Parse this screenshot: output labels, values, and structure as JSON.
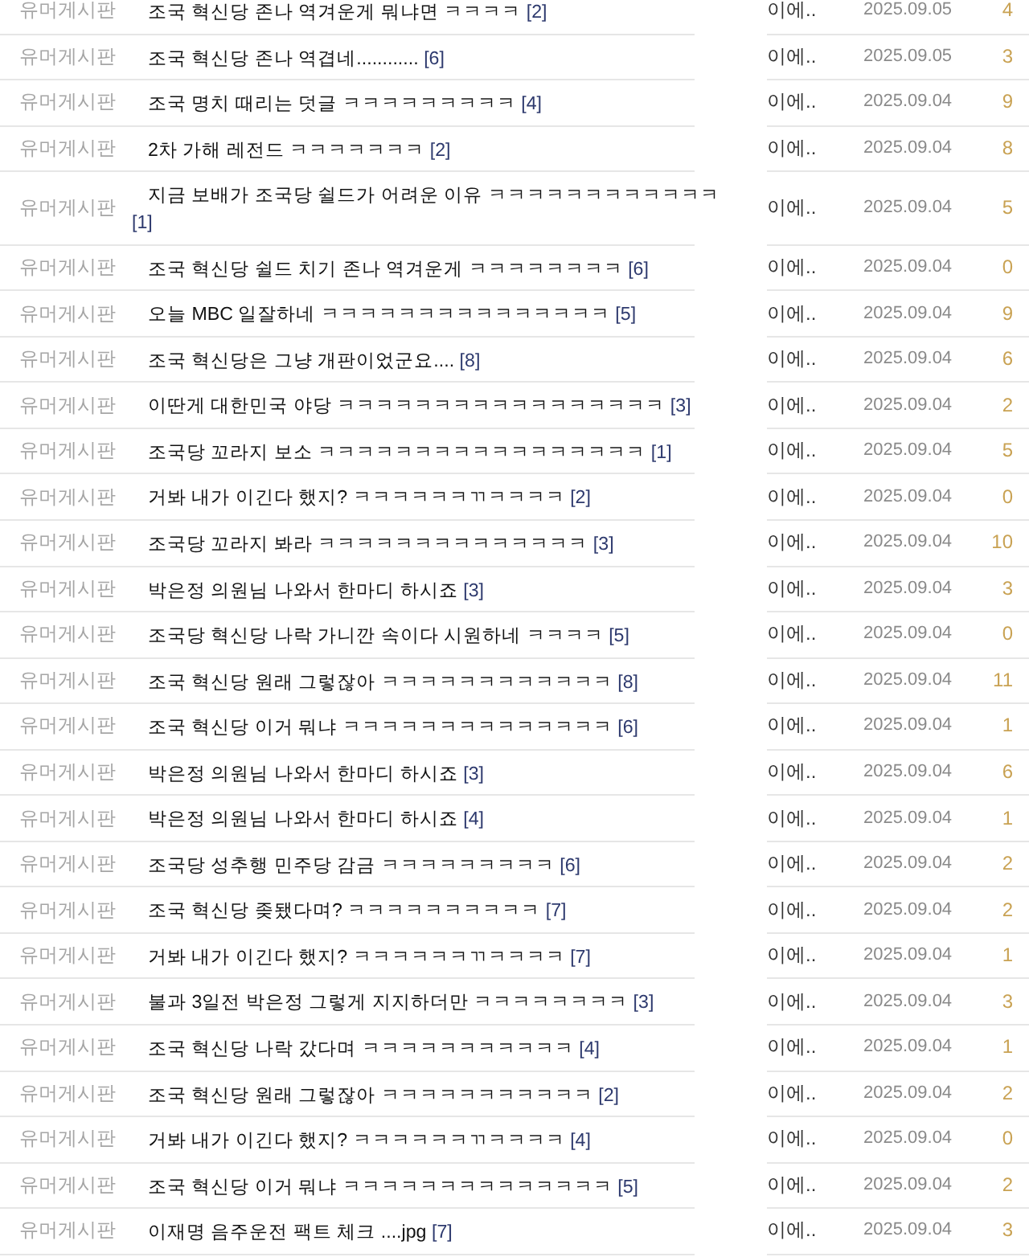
{
  "posts": [
    {
      "board": "유머게시판",
      "title": "조국 혁신당 존나 역겨운게 뭐냐면 ㅋㅋㅋㅋ",
      "comment_count": "[2]",
      "author": "이에..",
      "date": "2025.09.05",
      "count": "4"
    },
    {
      "board": "유머게시판",
      "title": "조국 혁신당 존나 역겹네............",
      "comment_count": "[6]",
      "author": "이에..",
      "date": "2025.09.05",
      "count": "3"
    },
    {
      "board": "유머게시판",
      "title": "조국 명치 때리는 덧글 ㅋㅋㅋㅋㅋㅋㅋㅋㅋ",
      "comment_count": "[4]",
      "author": "이에..",
      "date": "2025.09.04",
      "count": "9"
    },
    {
      "board": "유머게시판",
      "title": "2차 가해 레전드 ㅋㅋㅋㅋㅋㅋㅋ",
      "comment_count": "[2]",
      "author": "이에..",
      "date": "2025.09.04",
      "count": "8"
    },
    {
      "board": "유머게시판",
      "title": "지금 보배가 조국당 쉴드가 어려운 이유 ㅋㅋㅋㅋㅋㅋㅋㅋㅋㅋㅋㅋ",
      "comment_count": "[1]",
      "author": "이에..",
      "date": "2025.09.04",
      "count": "5"
    },
    {
      "board": "유머게시판",
      "title": "조국 혁신당 쉴드 치기 존나 역겨운게 ㅋㅋㅋㅋㅋㅋㅋㅋ",
      "comment_count": "[6]",
      "author": "이에..",
      "date": "2025.09.04",
      "count": "0"
    },
    {
      "board": "유머게시판",
      "title": "오늘 MBC 일잘하네 ㅋㅋㅋㅋㅋㅋㅋㅋㅋㅋㅋㅋㅋㅋㅋ",
      "comment_count": "[5]",
      "author": "이에..",
      "date": "2025.09.04",
      "count": "9"
    },
    {
      "board": "유머게시판",
      "title": "조국 혁신당은 그냥 개판이었군요....",
      "comment_count": "[8]",
      "author": "이에..",
      "date": "2025.09.04",
      "count": "6"
    },
    {
      "board": "유머게시판",
      "title": "이딴게 대한민국 야당 ㅋㅋㅋㅋㅋㅋㅋㅋㅋㅋㅋㅋㅋㅋㅋㅋㅋ",
      "comment_count": "[3]",
      "author": "이에..",
      "date": "2025.09.04",
      "count": "2"
    },
    {
      "board": "유머게시판",
      "title": "조국당 꼬라지 보소 ㅋㅋㅋㅋㅋㅋㅋㅋㅋㅋㅋㅋㅋㅋㅋㅋㅋ",
      "comment_count": "[1]",
      "author": "이에..",
      "date": "2025.09.04",
      "count": "5"
    },
    {
      "board": "유머게시판",
      "title": "거봐 내가 이긴다 했지? ㅋㅋㅋㅋㅋㅋㄲㅋㅋㅋㅋ",
      "comment_count": "[2]",
      "author": "이에..",
      "date": "2025.09.04",
      "count": "0"
    },
    {
      "board": "유머게시판",
      "title": "조국당 꼬라지 봐라 ㅋㅋㅋㅋㅋㅋㅋㅋㅋㅋㅋㅋㅋㅋ",
      "comment_count": "[3]",
      "author": "이에..",
      "date": "2025.09.04",
      "count": "10"
    },
    {
      "board": "유머게시판",
      "title": "박은정 의원님 나와서 한마디 하시죠",
      "comment_count": "[3]",
      "author": "이에..",
      "date": "2025.09.04",
      "count": "3"
    },
    {
      "board": "유머게시판",
      "title": "조국당 혁신당 나락 가니깐 속이다 시원하네 ㅋㅋㅋㅋ",
      "comment_count": "[5]",
      "author": "이에..",
      "date": "2025.09.04",
      "count": "0"
    },
    {
      "board": "유머게시판",
      "title": "조국 혁신당 원래 그렇잖아 ㅋㅋㅋㅋㅋㅋㅋㅋㅋㅋㅋㅋ",
      "comment_count": "[8]",
      "author": "이에..",
      "date": "2025.09.04",
      "count": "11"
    },
    {
      "board": "유머게시판",
      "title": "조국 혁신당 이거 뭐냐 ㅋㅋㅋㅋㅋㅋㅋㅋㅋㅋㅋㅋㅋㅋ",
      "comment_count": "[6]",
      "author": "이에..",
      "date": "2025.09.04",
      "count": "1"
    },
    {
      "board": "유머게시판",
      "title": "박은정 의원님 나와서 한마디 하시죠",
      "comment_count": "[3]",
      "author": "이에..",
      "date": "2025.09.04",
      "count": "6"
    },
    {
      "board": "유머게시판",
      "title": "박은정 의원님 나와서 한마디 하시죠",
      "comment_count": "[4]",
      "author": "이에..",
      "date": "2025.09.04",
      "count": "1"
    },
    {
      "board": "유머게시판",
      "title": "조국당 성추행 민주당 감금 ㅋㅋㅋㅋㅋㅋㅋㅋㅋ",
      "comment_count": "[6]",
      "author": "이에..",
      "date": "2025.09.04",
      "count": "2"
    },
    {
      "board": "유머게시판",
      "title": "조국 혁신당 좆됐다며? ㅋㅋㅋㅋㅋㅋㅋㅋㅋㅋ",
      "comment_count": "[7]",
      "author": "이에..",
      "date": "2025.09.04",
      "count": "2"
    },
    {
      "board": "유머게시판",
      "title": "거봐 내가 이긴다 했지? ㅋㅋㅋㅋㅋㅋㄲㅋㅋㅋㅋ",
      "comment_count": "[7]",
      "author": "이에..",
      "date": "2025.09.04",
      "count": "1"
    },
    {
      "board": "유머게시판",
      "title": "불과 3일전 박은정 그렇게 지지하더만 ㅋㅋㅋㅋㅋㅋㅋㅋ",
      "comment_count": "[3]",
      "author": "이에..",
      "date": "2025.09.04",
      "count": "3"
    },
    {
      "board": "유머게시판",
      "title": "조국 혁신당 나락 갔다며 ㅋㅋㅋㅋㅋㅋㅋㅋㅋㅋㅋ",
      "comment_count": "[4]",
      "author": "이에..",
      "date": "2025.09.04",
      "count": "1"
    },
    {
      "board": "유머게시판",
      "title": "조국 혁신당 원래 그렇잖아 ㅋㅋㅋㅋㅋㅋㅋㅋㅋㅋㅋ",
      "comment_count": "[2]",
      "author": "이에..",
      "date": "2025.09.04",
      "count": "2"
    },
    {
      "board": "유머게시판",
      "title": "거봐 내가 이긴다 했지? ㅋㅋㅋㅋㅋㅋㄲㅋㅋㅋㅋ",
      "comment_count": "[4]",
      "author": "이에..",
      "date": "2025.09.04",
      "count": "0"
    },
    {
      "board": "유머게시판",
      "title": "조국 혁신당 이거 뭐냐 ㅋㅋㅋㅋㅋㅋㅋㅋㅋㅋㅋㅋㅋㅋ",
      "comment_count": "[5]",
      "author": "이에..",
      "date": "2025.09.04",
      "count": "2"
    },
    {
      "board": "유머게시판",
      "title": "이재명 음주운전 팩트 체크 ....jpg",
      "comment_count": "[7]",
      "author": "이에..",
      "date": "2025.09.04",
      "count": "3"
    }
  ]
}
